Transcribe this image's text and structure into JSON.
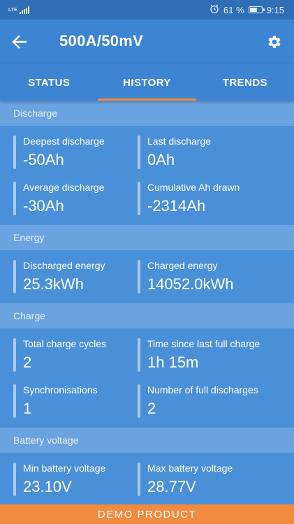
{
  "status_bar": {
    "network": "LTE",
    "battery_percent": "61 %",
    "time": "9:15",
    "icons": [
      "signal-icon",
      "alarm-icon",
      "battery-icon"
    ]
  },
  "app_bar": {
    "title": "500A/50mV",
    "back_icon": "arrow-left-icon",
    "settings_icon": "gear-icon"
  },
  "tabs": [
    {
      "label": "STATUS",
      "active": false
    },
    {
      "label": "HISTORY",
      "active": true
    },
    {
      "label": "TRENDS",
      "active": false
    }
  ],
  "sections": [
    {
      "title": "Discharge",
      "stats": [
        {
          "label": "Deepest discharge",
          "value": "-50Ah"
        },
        {
          "label": "Last discharge",
          "value": "0Ah"
        },
        {
          "label": "Average discharge",
          "value": "-30Ah"
        },
        {
          "label": "Cumulative Ah drawn",
          "value": "-2314Ah"
        }
      ]
    },
    {
      "title": "Energy",
      "stats": [
        {
          "label": "Discharged energy",
          "value": "25.3kWh"
        },
        {
          "label": "Charged energy",
          "value": "14052.0kWh"
        }
      ]
    },
    {
      "title": "Charge",
      "stats": [
        {
          "label": "Total charge cycles",
          "value": "2"
        },
        {
          "label": "Time since last full charge",
          "value": "1h 15m"
        },
        {
          "label": "Synchronisations",
          "value": "1"
        },
        {
          "label": "Number of full discharges",
          "value": "2"
        }
      ]
    },
    {
      "title": "Battery voltage",
      "stats": [
        {
          "label": "Min battery voltage",
          "value": "23.10V"
        },
        {
          "label": "Max battery voltage",
          "value": "28.77V"
        }
      ]
    }
  ],
  "banner": {
    "label": "DEMO PRODUCT"
  },
  "colors": {
    "status_bar": "#2f6fb8",
    "app_bar": "#3d84d3",
    "section_header": "#6aa3e0",
    "body": "#4a90d9",
    "accent": "#f58a3c",
    "banner": "#f28b3e"
  }
}
